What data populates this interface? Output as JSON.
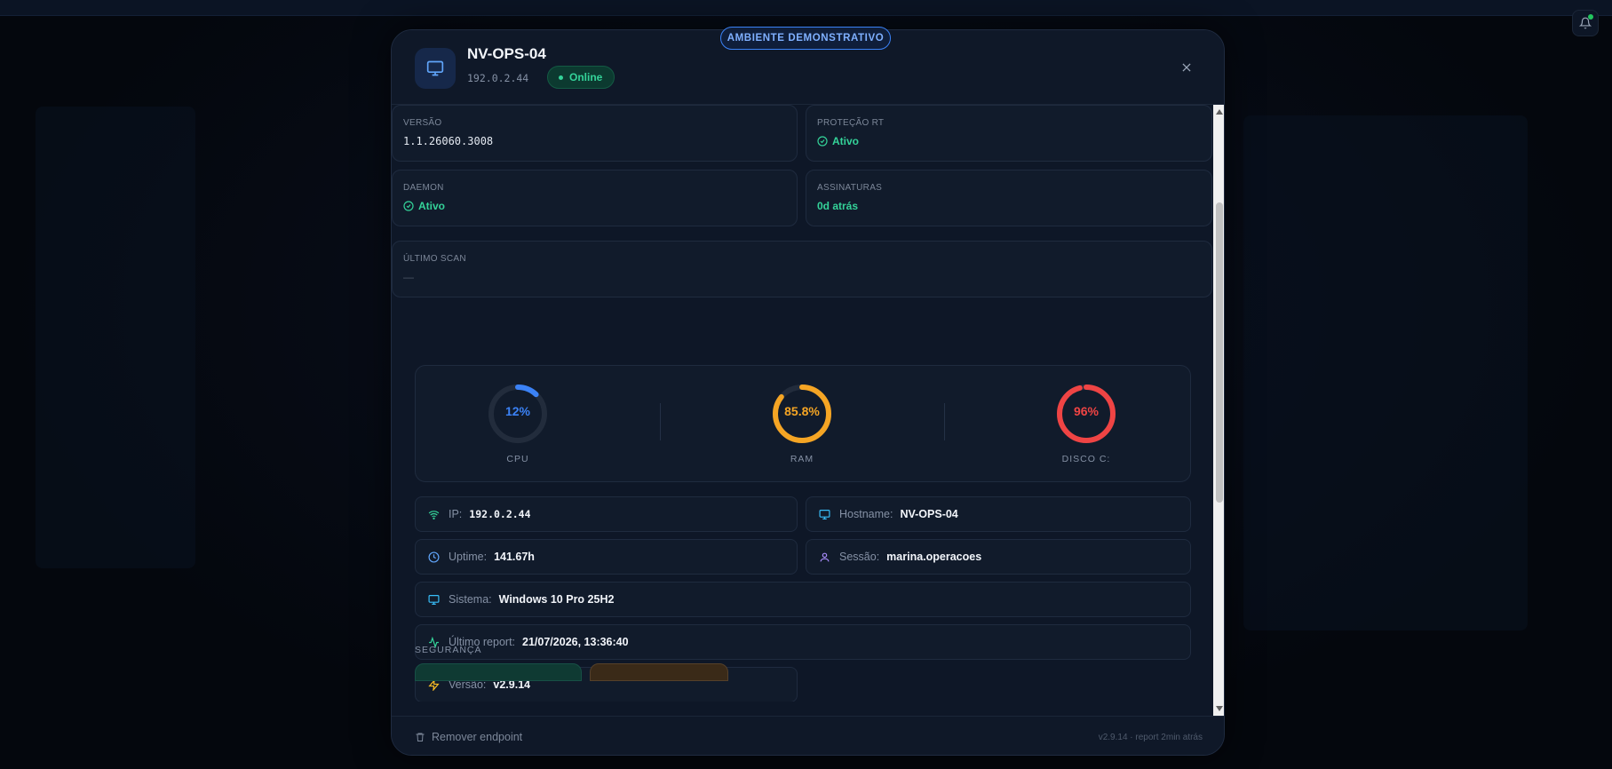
{
  "badge": "AMBIENTE DEMONSTRATIVO",
  "device": {
    "name": "NV-OPS-04",
    "ip": "192.0.2.44",
    "status": "Online",
    "icon": "monitor-icon"
  },
  "cards": {
    "versao": {
      "label": "VERSÃO",
      "value": "1.1.26060.3008"
    },
    "protecao": {
      "label": "PROTEÇÃO RT",
      "value": "Ativo"
    },
    "daemon": {
      "label": "DAEMON",
      "value": "Ativo"
    },
    "assinaturas": {
      "label": "ASSINATURAS",
      "value": "0d atrás"
    },
    "ultimo_scan": {
      "label": "ÚLTIMO SCAN",
      "value": "—"
    }
  },
  "gauges": [
    {
      "name": "CPU",
      "label": "12%",
      "value": 12,
      "color": "#3b82f6"
    },
    {
      "name": "RAM",
      "label": "85.8%",
      "value": 85.8,
      "color": "#f5a524"
    },
    {
      "name": "DISCO C:",
      "label": "96%",
      "value": 96,
      "color": "#ef4444"
    }
  ],
  "info": {
    "ip": {
      "key": "IP:",
      "value": "192.0.2.44",
      "icon": "wifi-icon"
    },
    "hostname": {
      "key": "Hostname:",
      "value": "NV-OPS-04",
      "icon": "monitor-icon"
    },
    "uptime": {
      "key": "Uptime:",
      "value": "141.67h",
      "icon": "clock-icon"
    },
    "sessao": {
      "key": "Sessão:",
      "value": "marina.operacoes",
      "icon": "user-icon"
    },
    "sistema": {
      "key": "Sistema:",
      "value": "Windows 10 Pro 25H2",
      "icon": "monitor-icon"
    },
    "ultimo_report": {
      "key": "Último report:",
      "value": "21/07/2026, 13:36:40",
      "icon": "activity-icon"
    },
    "versao": {
      "key": "Versão:",
      "value": "v2.9.14",
      "icon": "bolt-icon"
    }
  },
  "security_title": "SEGURANÇA",
  "footer": {
    "remove_label": "Remover endpoint",
    "meta": "v2.9.14 · report 2min atrás"
  },
  "colors": {
    "accent": "#3b82f6",
    "success": "#34d399",
    "warning": "#f5a524",
    "danger": "#ef4444"
  }
}
